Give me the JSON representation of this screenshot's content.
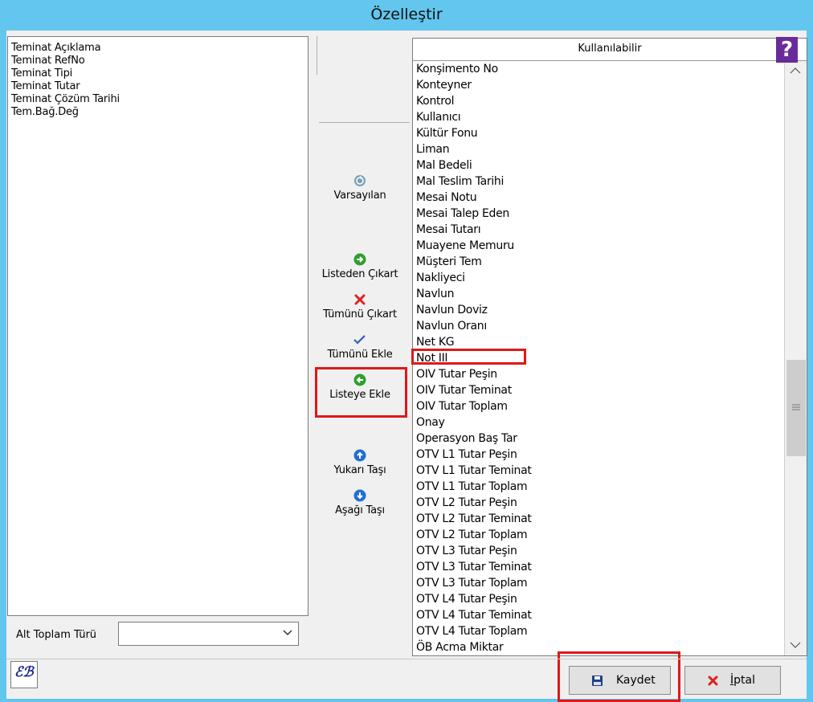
{
  "window": {
    "title": "Özelleştir"
  },
  "selected_list": {
    "items": [
      "Teminat Açıklama",
      "Teminat RefNo",
      "Teminat Tipi",
      "Teminat Tutar",
      "Teminat Çözüm Tarihi",
      "Tem.Bağ.Değ"
    ]
  },
  "subtotal": {
    "label": "Alt Toplam Türü",
    "value": ""
  },
  "actions": {
    "defaults": "Varsayılan",
    "remove": "Listeden Çıkart",
    "remove_all": "Tümünü Çıkart",
    "add_all": "Tümünü Ekle",
    "add": "Listeye Ekle",
    "move_up": "Yukarı Taşı",
    "move_down": "Aşağı Taşı"
  },
  "available_list": {
    "header": "Kullanılabilir",
    "items": [
      "Konşimento No",
      "Konteyner",
      "Kontrol",
      "Kullanıcı",
      "Kültür Fonu",
      "Liman",
      "Mal Bedeli",
      "Mal Teslim Tarihi",
      "Mesai Notu",
      "Mesai Talep Eden",
      "Mesai Tutarı",
      "Muayene Memuru",
      "Müşteri Tem",
      "Nakliyeci",
      "Navlun",
      "Navlun Doviz",
      "Navlun Oranı",
      "Net KG",
      "Not III",
      "OIV Tutar Peşin",
      "OIV Tutar Teminat",
      "OIV Tutar Toplam",
      "Onay",
      "Operasyon Baş Tar",
      "OTV L1 Tutar Peşin",
      "OTV L1 Tutar Teminat",
      "OTV L1 Tutar Toplam",
      "OTV L2 Tutar Peşin",
      "OTV L2 Tutar Teminat",
      "OTV L2 Tutar Toplam",
      "OTV L3 Tutar Peşin",
      "OTV L3 Tutar Teminat",
      "OTV L3 Tutar Toplam",
      "OTV L4 Tutar Peşin",
      "OTV L4 Tutar Teminat",
      "OTV L4 Tutar Toplam",
      "ÖB Acma Miktar"
    ]
  },
  "help": {
    "symbol": "?"
  },
  "logo": {
    "text": "ℰℬ"
  },
  "buttons": {
    "save": "Kaydet",
    "cancel": "İptal"
  },
  "colors": {
    "titlebar": "#62c6ef",
    "highlight": "#e01818",
    "help_bg": "#6a2b9a"
  }
}
